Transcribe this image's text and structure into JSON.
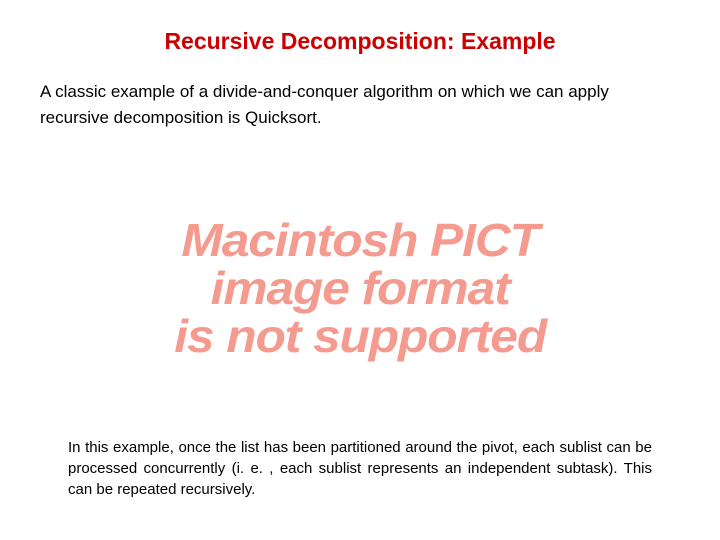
{
  "title": "Recursive Decomposition: Example",
  "intro": "A classic example of a divide-and-conquer algorithm on which we can apply recursive decomposition is Quicksort.",
  "placeholder": {
    "line1": "Macintosh PICT",
    "line2": "image format",
    "line3": "is not supported"
  },
  "footnote": "In this example, once the list has been partitioned around the pivot, each sublist can be processed concurrently (i. e. , each sublist represents an independent subtask). This can be repeated recursively."
}
